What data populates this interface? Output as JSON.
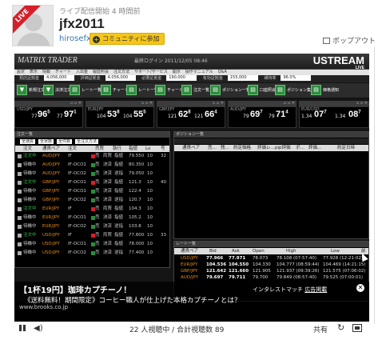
{
  "header": {
    "live_badge": "LIVE",
    "started": "ライブ配信開始 4 時間前",
    "channel": "jfx2011",
    "user": "hirosefx",
    "join": "コミュニティに参加",
    "popout": "ポップアウト"
  },
  "screen": {
    "brand": "MATRIX TRADER",
    "clock": "最終ログイン 2011/12/05 08:46",
    "ustream": "USTREAM",
    "ustream_small": "LIVE",
    "menu": [
      "設定",
      "表示",
      "情報",
      "チャート",
      "入出金",
      "履歴照会",
      "注文方法",
      "サポート/サービス",
      "開示",
      "操作マニュアル",
      "Q&A"
    ],
    "info": [
      {
        "label": "預託証拠金",
        "value": "4,056,000"
      },
      {
        "label": "評価証拠金",
        "value": "4,056,000"
      },
      {
        "label": "必要証拠金",
        "value": "190,000"
      },
      {
        "label": "有効証拠金",
        "value": "155,000"
      },
      {
        "label": "維持率",
        "value": "96.0%"
      }
    ],
    "toolbar": [
      "新規注文",
      "決済注文",
      "レート一覧",
      "チャート",
      "レート一覧",
      "チャート",
      "注文一覧",
      "ポジション一覧",
      "口座照会",
      "ポジション集計",
      "価格通知"
    ],
    "quotes": [
      {
        "pair": "USD/JPY",
        "sell_s": "77",
        "sell_b": "96",
        "sell_p": "5",
        "buy_s": "77",
        "buy_b": "97",
        "buy_p": "1"
      },
      {
        "pair": "EUR/JPY",
        "sell_s": "104",
        "sell_b": "53",
        "sell_p": "8",
        "buy_s": "104",
        "buy_b": "55",
        "buy_p": "5"
      },
      {
        "pair": "GBP/JPY",
        "sell_s": "121",
        "sell_b": "62",
        "sell_p": "8",
        "buy_s": "121",
        "buy_b": "66",
        "buy_p": "4"
      },
      {
        "pair": "AUD/JPY",
        "sell_s": "79",
        "sell_b": "69",
        "sell_p": "7",
        "buy_s": "79",
        "buy_b": "71",
        "buy_p": "4"
      },
      {
        "pair": "EUR/USD",
        "sell_s": "1.34",
        "sell_b": "07",
        "sell_p": "7",
        "buy_s": "1.34",
        "buy_b": "08",
        "buy_p": "7"
      }
    ],
    "orders": {
      "title": "注文一覧",
      "filter": [
        "全通貨",
        "全状態",
        "全件数",
        "全注文方法"
      ],
      "cols": [
        "注文",
        "通貨ペア",
        "注文",
        "売買",
        "執行",
        "指値",
        "Lo",
        "号"
      ],
      "rows": [
        {
          "status": "注文中",
          "pair": "AUD/JPY",
          "type": "IF",
          "side": "売",
          "kind": "両買",
          "exe": "指値",
          "price": "79.550",
          "lot": "10",
          "no": "32"
        },
        {
          "status": "待機中",
          "pair": "AUD/JPY",
          "type": "IF-OCO1",
          "side": "売",
          "kind": "決済",
          "exe": "指値",
          "price": "80.350",
          "lot": "10",
          "no": ""
        },
        {
          "status": "待機中",
          "pair": "AUD/JPY",
          "type": "IF-OCO2",
          "side": "売",
          "kind": "決済",
          "exe": "逆指",
          "price": "79.050",
          "lot": "10",
          "no": ""
        },
        {
          "status": "注文中",
          "pair": "GBP/JPY",
          "type": "IF-OCO1",
          "side": "売",
          "kind": "決済",
          "exe": "指値",
          "price": "121.3",
          "lot": "10",
          "no": "40"
        },
        {
          "status": "待機中",
          "pair": "GBP/JPY",
          "type": "IF-OCO1",
          "side": "売",
          "kind": "決済",
          "exe": "指値",
          "price": "122.4",
          "lot": "10",
          "no": ""
        },
        {
          "status": "待機中",
          "pair": "GBP/JPY",
          "type": "IF-OCO2",
          "side": "売",
          "kind": "決済",
          "exe": "逆指",
          "price": "120.7",
          "lot": "10",
          "no": ""
        },
        {
          "status": "注文中",
          "pair": "EUR/JPY",
          "type": "IF",
          "side": "売",
          "kind": "両買",
          "exe": "指値",
          "price": "104.3",
          "lot": "10",
          "no": ""
        },
        {
          "status": "待機中",
          "pair": "EUR/JPY",
          "type": "IF-OCO1",
          "side": "売",
          "kind": "決済",
          "exe": "指値",
          "price": "105.2",
          "lot": "10",
          "no": ""
        },
        {
          "status": "待機中",
          "pair": "EUR/JPY",
          "type": "IF-OCO2",
          "side": "売",
          "kind": "決済",
          "exe": "逆指",
          "price": "103.8",
          "lot": "10",
          "no": ""
        },
        {
          "status": "注文中",
          "pair": "USD/JPY",
          "type": "IF",
          "side": "売",
          "kind": "両買",
          "exe": "指値",
          "price": "77.800",
          "lot": "10",
          "no": "33"
        },
        {
          "status": "待機中",
          "pair": "USD/JPY",
          "type": "IF-OCO1",
          "side": "売",
          "kind": "決済",
          "exe": "指値",
          "price": "78.000",
          "lot": "10",
          "no": ""
        },
        {
          "status": "待機中",
          "pair": "USD/JPY",
          "type": "IF-OCO2",
          "side": "売",
          "kind": "決済",
          "exe": "逆指",
          "price": "77.400",
          "lot": "10",
          "no": ""
        }
      ]
    },
    "positions": {
      "title": "ポジション一覧",
      "cols": [
        "通貨ペア",
        "売…",
        "残…",
        "約定価格",
        "評価レ…",
        "pip評価",
        "ポ…",
        "評価…",
        "約定日時"
      ]
    },
    "rates": {
      "title": "レート一覧",
      "cols": [
        "通貨ペア",
        "Bid",
        "Ask",
        "Open",
        "High",
        "Low",
        "前"
      ],
      "rows": [
        {
          "pair": "USD/JPY",
          "bid": "77.966",
          "ask": "77.971",
          "open": "78.073",
          "high": "78.108 (07:57:40)",
          "low": "77.928 (12:21:02)"
        },
        {
          "pair": "EUR/JPY",
          "bid": "104.536",
          "ask": "104.550",
          "open": "104.330",
          "high": "104.777 (08:59:44)",
          "low": "104.469 (14:21:15)"
        },
        {
          "pair": "GBP/JPY",
          "bid": "121.642",
          "ask": "121.660",
          "open": "121.905",
          "high": "121.937 (09:39:26)",
          "low": "121.575 (07:06:02)"
        },
        {
          "pair": "AUD/JPY",
          "bid": "79.697",
          "ask": "79.711",
          "open": "79.700",
          "high": "79.849 (08:57:40)",
          "low": "79.525 (07:00:01)"
        }
      ]
    }
  },
  "ad": {
    "title": "【1杯19円】珈琲カプチーノ！",
    "body": "《送料無料！期間限定》コーヒー職人が仕上げた本格カプチーノとは？",
    "url": "www.brooks.co.jp",
    "label_pre": "インタレストマッチ",
    "label_link": "広告掲載"
  },
  "controls": {
    "viewers": "22 人視聴中 / 合計視聴数 89",
    "share": "共有"
  }
}
